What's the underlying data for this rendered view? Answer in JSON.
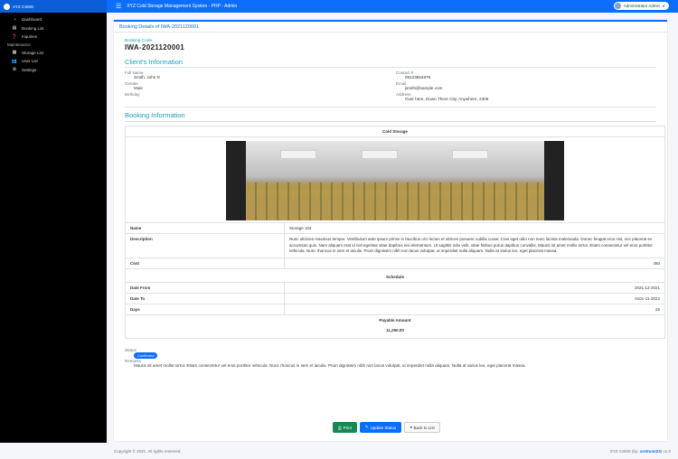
{
  "topbar": {
    "brand": "XYZ CSMS",
    "menu_icon": "hamburger-icon",
    "app_title": "XYZ Cold Storage Management System - PHP - Admin",
    "user": "Administrator Admin"
  },
  "sidebar": {
    "items": [
      {
        "icon": "dashboard-icon",
        "glyph": "◔",
        "label": "Dashboard"
      },
      {
        "icon": "booking-list-icon",
        "glyph": "▤",
        "label": "Booking List"
      },
      {
        "icon": "inquiries-icon",
        "glyph": "❓",
        "label": "Inquiries"
      }
    ],
    "maintenance_header": "Maintenance",
    "maintenance_items": [
      {
        "icon": "storage-list-icon",
        "glyph": "▦",
        "label": "Storage List"
      },
      {
        "icon": "user-list-icon",
        "glyph": "👥",
        "label": "User List"
      },
      {
        "icon": "settings-icon",
        "glyph": "⚙",
        "label": "Settings"
      }
    ]
  },
  "header": {
    "title": "Booking Details of IWA-2021120001"
  },
  "booking": {
    "code_label": "Booking Code",
    "code": "IWA-2021120001"
  },
  "client": {
    "section_title": "Client's Information",
    "fullname_label": "Full Name",
    "fullname": "Smith, John D",
    "contact_label": "Contact #",
    "contact": "09123654879",
    "gender_label": "Gender",
    "gender": "Male",
    "email_label": "Email",
    "email": "jsmith@sample.com",
    "birthday_label": "Birthday",
    "birthday": "",
    "address_label": "Address",
    "address": "Over here, Down There City, Anywhere, 2306"
  },
  "booking_info": {
    "section_title": "Booking Information",
    "storage_heading": "Cold Storage",
    "name_label": "Name",
    "name": "Storage 104",
    "description_label": "Description",
    "description": "Nunc ultricies maximus tempor. Vestibulum ante ipsum primis in faucibus orci luctus et ultrices posuere cubilia curae; Cras eget odio non nunc lacinia malesuada. Donec feugiat eros nisl, nec placerat ex accumsan quis. Nam aliquam erat id nisl egestas vitae dapibus nisi elementum. Ut sagittis odio velit, vitae finibus purus dapibus convallis. Mauris sit amet mollis tortor. Etiam consectetur vel eros porttitor vehicula. Nunc rhoncus in sem et iaculis. Proin dignissim nibh non lacus volutpat, ut imperdiet nulla aliquam. Nulla at varius leo, eget placerat massa.",
    "cost_label": "Cost",
    "cost": "450",
    "schedule_heading": "Schedule",
    "date_from_label": "Date From",
    "date_from": "2021-12-2021",
    "date_to_label": "Date To",
    "date_to": "0101-11-2022",
    "days_label": "Days",
    "days": "25",
    "payable_heading": "Payable Amount",
    "payable": "11,250.00"
  },
  "status": {
    "label": "Status",
    "badge": "Confirmed",
    "remarks_label": "Remarks",
    "remarks": "Mauris sit amet mollis tortor. Etiam consectetur vel eros porttitor vehicula. Nunc rhoncus in sem et iaculis. Proin dignissim nibh non lacus volutpat, ut imperdiet nulla aliquam. Nulla at varius leo, eget placerat massa."
  },
  "actions": {
    "print": "Print",
    "update": "Update Status",
    "back": "Back to List"
  },
  "footer": {
    "copyright": "Copyright © 2021. All rights reserved.",
    "credit_prefix": "XYZ CSMS (by: ",
    "credit_name": "oretnom23",
    "credit_suffix": ") v1.0"
  }
}
